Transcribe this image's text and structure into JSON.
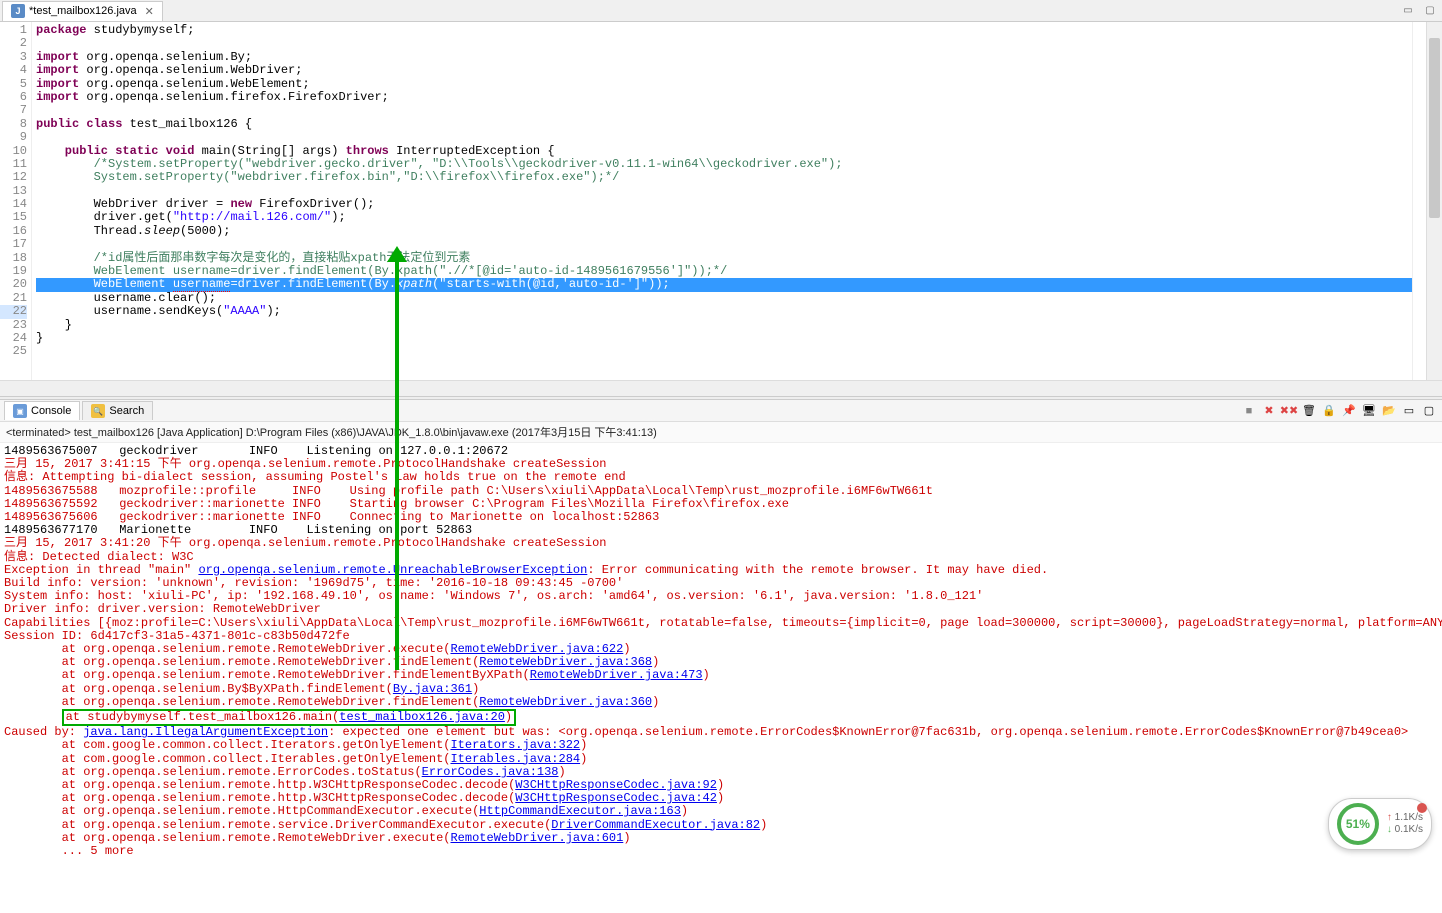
{
  "tab": {
    "filename": "*test_mailbox126.java"
  },
  "code": {
    "lines": [
      {
        "n": 1,
        "t": "package",
        "c": " studybymyself;"
      },
      {
        "n": 2,
        "t": "",
        "c": ""
      },
      {
        "n": 3,
        "t": "import",
        "c": " org.openqa.selenium.By;"
      },
      {
        "n": 4,
        "t": "import",
        "c": " org.openqa.selenium.WebDriver;"
      },
      {
        "n": 5,
        "t": "import",
        "c": " org.openqa.selenium.WebElement;"
      },
      {
        "n": 6,
        "t": "import",
        "c": " org.openqa.selenium.firefox.FirefoxDriver;"
      },
      {
        "n": 7,
        "t": "",
        "c": ""
      },
      {
        "n": 8,
        "t": "public class",
        "c": " test_mailbox126 {"
      },
      {
        "n": 9,
        "t": "",
        "c": ""
      },
      {
        "n": 10,
        "t": "    public static void",
        "c2": " main(String[] args) ",
        "t2": "throws",
        "c3": " InterruptedException {"
      },
      {
        "n": 11,
        "cmt": "        /*System.setProperty(\"webdriver.gecko.driver\", \"D:\\\\Tools\\\\geckodriver-v0.11.1-win64\\\\geckodriver.exe\");"
      },
      {
        "n": 12,
        "cmt": "        System.setProperty(\"webdriver.firefox.bin\",\"D:\\\\firefox\\\\firefox.exe\");*/"
      },
      {
        "n": 13,
        "t": "",
        "c": ""
      },
      {
        "n": 14,
        "plain": "        WebDriver driver = ",
        "kw": "new",
        "after": " FirefoxDriver();"
      },
      {
        "n": 15,
        "plain": "        driver.get(",
        "str": "\"http://mail.126.com/\"",
        "after": ");"
      },
      {
        "n": 16,
        "plain": "        Thread.",
        "it": "sleep",
        "after": "(5000);"
      },
      {
        "n": 17,
        "t": "",
        "c": ""
      },
      {
        "n": 18,
        "cmt": "        /*id属性后面那串数字每次是变化的，直接粘贴xpath无法定位到元素"
      },
      {
        "n": 19,
        "cmt": "        WebElement username=driver.findElement(By.xpath(\".//*[@id='auto-id-1489561679556']\"));*/"
      },
      {
        "n": 20,
        "hl": true,
        "plain": "        WebElement username=driver.findElement(By.",
        "it": "xpath",
        "after": "(",
        "str": "\"starts-with(@id,'auto-id-']\"",
        "after2": "));"
      },
      {
        "n": 21,
        "plain": "        username.clear();"
      },
      {
        "n": 22,
        "plain": "        username.sendKeys(",
        "str": "\"AAAA\"",
        "after": ");"
      },
      {
        "n": 23,
        "plain": "    }"
      },
      {
        "n": 24,
        "plain": "}"
      },
      {
        "n": 25,
        "plain": ""
      }
    ]
  },
  "console": {
    "tab1": "Console",
    "tab2": "Search",
    "status": "<terminated> test_mailbox126 [Java Application] D:\\Program Files (x86)\\JAVA\\JDK_1.8.0\\bin\\javaw.exe (2017年3月15日 下午3:41:13)",
    "lines": [
      {
        "cls": "c-black",
        "txt": "1489563675007   geckodriver       INFO    Listening on 127.0.0.1:20672"
      },
      {
        "cls": "c-red",
        "txt": "三月 15, 2017 3:41:15 下午 org.openqa.selenium.remote.ProtocolHandshake createSession"
      },
      {
        "cls": "c-red",
        "txt": "信息: Attempting bi-dialect session, assuming Postel's Law holds true on the remote end"
      },
      {
        "cls": "c-red",
        "txt": "1489563675588   mozprofile::profile     INFO    Using profile path C:\\Users\\xiuli\\AppData\\Local\\Temp\\rust_mozprofile.i6MF6wTW661t"
      },
      {
        "cls": "c-red",
        "txt": "1489563675592   geckodriver::marionette INFO    Starting browser C:\\Program Files\\Mozilla Firefox\\firefox.exe"
      },
      {
        "cls": "c-red",
        "txt": "1489563675606   geckodriver::marionette INFO    Connecting to Marionette on localhost:52863"
      },
      {
        "cls": "c-black",
        "txt": "1489563677170   Marionette        INFO    Listening on port 52863"
      },
      {
        "cls": "c-red",
        "txt": "三月 15, 2017 3:41:20 下午 org.openqa.selenium.remote.ProtocolHandshake createSession"
      },
      {
        "cls": "c-red",
        "txt": "信息: Detected dialect: W3C"
      },
      {
        "mixed": true,
        "pre": "Exception in thread \"main\" ",
        "link": "org.openqa.selenium.remote.UnreachableBrowserException",
        "post": ": Error communicating with the remote browser. It may have died."
      },
      {
        "cls": "c-red",
        "txt": "Build info: version: 'unknown', revision: '1969d75', time: '2016-10-18 09:43:45 -0700'"
      },
      {
        "cls": "c-red",
        "txt": "System info: host: 'xiuli-PC', ip: '192.168.49.10', os.name: 'Windows 7', os.arch: 'amd64', os.version: '6.1', java.version: '1.8.0_121'"
      },
      {
        "cls": "c-red",
        "txt": "Driver info: driver.version: RemoteWebDriver"
      },
      {
        "cls": "c-red",
        "txt": "Capabilities [{moz:profile=C:\\Users\\xiuli\\AppData\\Local\\Temp\\rust_mozprofile.i6MF6wTW661t, rotatable=false, timeouts={implicit=0, page load=300000, script=30000}, pageLoadStrategy=normal, platform=ANY, spe"
      },
      {
        "cls": "c-red",
        "txt": "Session ID: 6d417cf3-31a5-4371-801c-c83b50d472fe"
      },
      {
        "st": true,
        "pre": "        at org.openqa.selenium.remote.RemoteWebDriver.execute(",
        "link": "RemoteWebDriver.java:622",
        "post": ")"
      },
      {
        "st": true,
        "pre": "        at org.openqa.selenium.remote.RemoteWebDriver.findElement(",
        "link": "RemoteWebDriver.java:368",
        "post": ")"
      },
      {
        "st": true,
        "pre": "        at org.openqa.selenium.remote.RemoteWebDriver.findElementByXPath(",
        "link": "RemoteWebDriver.java:473",
        "post": ")"
      },
      {
        "st": true,
        "pre": "        at org.openqa.selenium.By$ByXPath.findElement(",
        "link": "By.java:361",
        "post": ")"
      },
      {
        "st": true,
        "pre": "        at org.openqa.selenium.remote.RemoteWebDriver.findElement(",
        "link": "RemoteWebDriver.java:360",
        "post": ")"
      },
      {
        "box": true,
        "pre": "        at studybymyself.test_mailbox126.main(",
        "link": "test_mailbox126.java:20",
        "post": ")"
      },
      {
        "mixed": true,
        "pre": "Caused by: ",
        "link": "java.lang.IllegalArgumentException",
        "post": ": expected one element but was: <org.openqa.selenium.remote.ErrorCodes$KnownError@7fac631b, org.openqa.selenium.remote.ErrorCodes$KnownError@7b49cea0>"
      },
      {
        "st": true,
        "pre": "        at com.google.common.collect.Iterators.getOnlyElement(",
        "link": "Iterators.java:322",
        "post": ")"
      },
      {
        "st": true,
        "pre": "        at com.google.common.collect.Iterables.getOnlyElement(",
        "link": "Iterables.java:284",
        "post": ")"
      },
      {
        "st": true,
        "pre": "        at org.openqa.selenium.remote.ErrorCodes.toStatus(",
        "link": "ErrorCodes.java:138",
        "post": ")"
      },
      {
        "st": true,
        "pre": "        at org.openqa.selenium.remote.http.W3CHttpResponseCodec.decode(",
        "link": "W3CHttpResponseCodec.java:92",
        "post": ")"
      },
      {
        "st": true,
        "pre": "        at org.openqa.selenium.remote.http.W3CHttpResponseCodec.decode(",
        "link": "W3CHttpResponseCodec.java:42",
        "post": ")"
      },
      {
        "st": true,
        "pre": "        at org.openqa.selenium.remote.HttpCommandExecutor.execute(",
        "link": "HttpCommandExecutor.java:163",
        "post": ")"
      },
      {
        "st": true,
        "pre": "        at org.openqa.selenium.remote.service.DriverCommandExecutor.execute(",
        "link": "DriverCommandExecutor.java:82",
        "post": ")"
      },
      {
        "st": true,
        "pre": "        at org.openqa.selenium.remote.RemoteWebDriver.execute(",
        "link": "RemoteWebDriver.java:601",
        "post": ")"
      },
      {
        "cls": "c-red",
        "txt": "        ... 5 more"
      }
    ]
  },
  "widget": {
    "pct": "51%",
    "up": "1.1K/s",
    "down": "0.1K/s"
  }
}
